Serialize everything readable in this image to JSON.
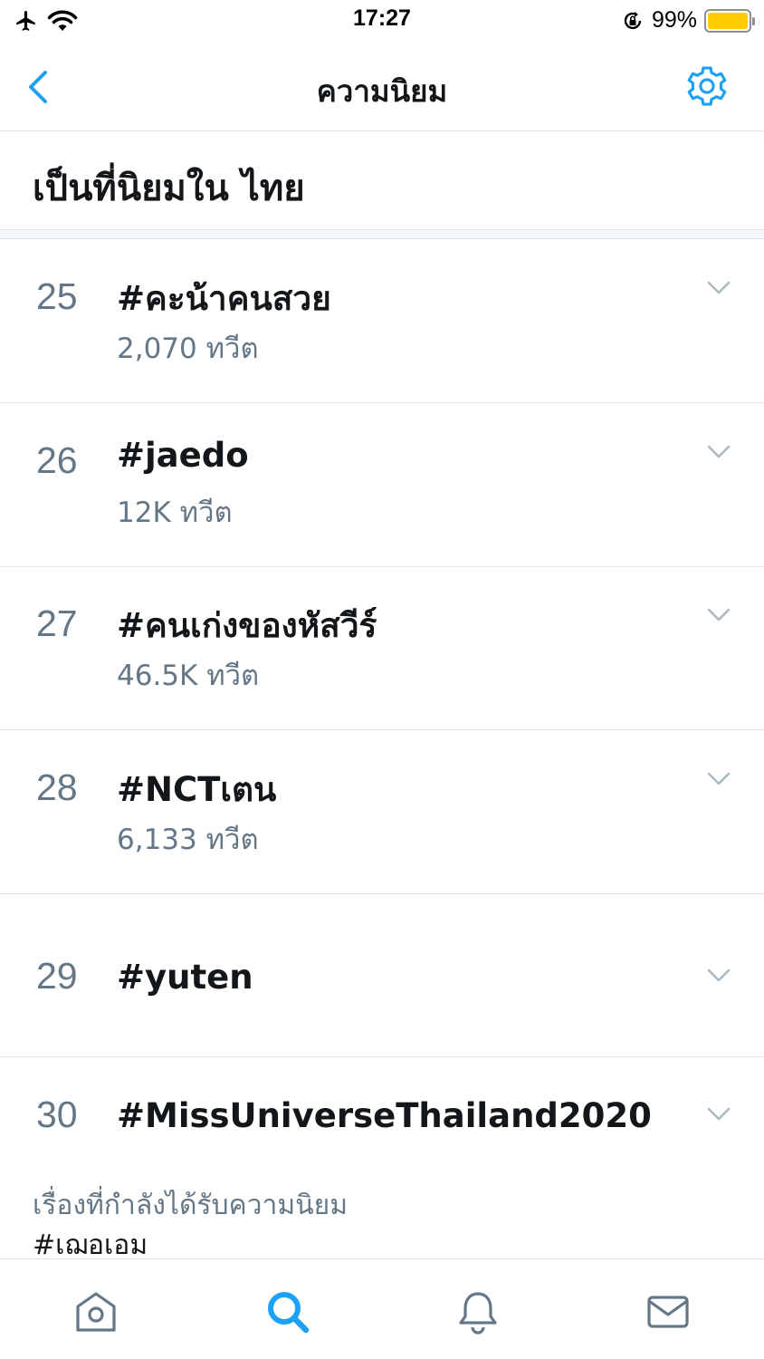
{
  "status_bar": {
    "time": "17:27",
    "battery_percent": "99%",
    "battery_level": 0.99,
    "icons": [
      "airplane-icon",
      "wifi-icon",
      "orientation-lock-icon",
      "battery-icon"
    ]
  },
  "nav": {
    "title": "ความนิยม",
    "back_icon": "chevron-left-icon",
    "settings_icon": "gear-icon"
  },
  "section": {
    "title": "เป็นที่นิยมใน ไทย"
  },
  "trends": [
    {
      "rank": "25",
      "tag": "#คะน้าคนสวย",
      "count": "2,070 ทวีต"
    },
    {
      "rank": "26",
      "tag": "#jaedo",
      "count": "12K ทวีต"
    },
    {
      "rank": "27",
      "tag": "#คนเก่งของหัสวีร์",
      "count": "46.5K ทวีต"
    },
    {
      "rank": "28",
      "tag": "#NCTเตน",
      "count": "6,133 ทวีต"
    },
    {
      "rank": "29",
      "tag": "#yuten",
      "count": ""
    },
    {
      "rank": "30",
      "tag": "#MissUniverseThailand2020",
      "count": "",
      "context": "เรื่องที่กำลังได้รับความนิยม",
      "context_tag": "#เฌอเอม"
    }
  ],
  "tab_bar": {
    "tabs": [
      {
        "name": "home",
        "icon": "home-icon",
        "active": false
      },
      {
        "name": "search",
        "icon": "search-icon",
        "active": true
      },
      {
        "name": "notifications",
        "icon": "bell-icon",
        "active": false
      },
      {
        "name": "messages",
        "icon": "mail-icon",
        "active": false
      }
    ]
  },
  "colors": {
    "accent": "#1da1f2",
    "text_primary": "#14171a",
    "text_secondary": "#657786",
    "divider": "#dfe3e8",
    "battery": "#ffcc00"
  }
}
